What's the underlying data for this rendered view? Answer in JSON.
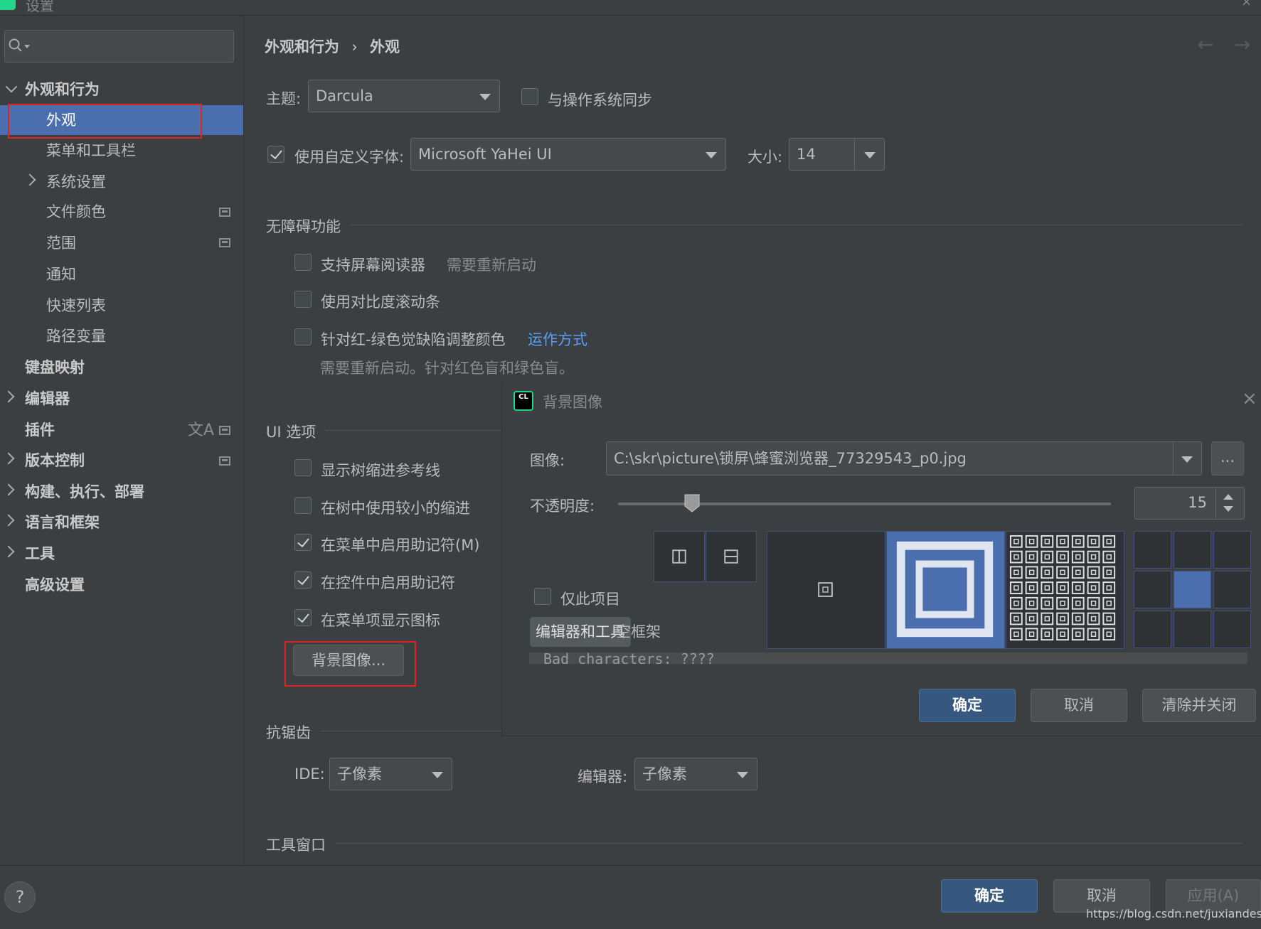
{
  "window": {
    "title": "设置"
  },
  "search": {
    "placeholder": ""
  },
  "sidebar": {
    "items": [
      {
        "label": "外观和行为"
      },
      {
        "label": "外观"
      },
      {
        "label": "菜单和工具栏"
      },
      {
        "label": "系统设置"
      },
      {
        "label": "文件颜色"
      },
      {
        "label": "范围"
      },
      {
        "label": "通知"
      },
      {
        "label": "快速列表"
      },
      {
        "label": "路径变量"
      },
      {
        "label": "键盘映射"
      },
      {
        "label": "编辑器"
      },
      {
        "label": "插件"
      },
      {
        "label": "版本控制"
      },
      {
        "label": "构建、执行、部署"
      },
      {
        "label": "语言和框架"
      },
      {
        "label": "工具"
      },
      {
        "label": "高级设置"
      }
    ]
  },
  "breadcrumb": {
    "parent": "外观和行为",
    "sep": "›",
    "current": "外观"
  },
  "theme": {
    "label": "主题:",
    "value": "Darcula",
    "sync_label": "与操作系统同步"
  },
  "font": {
    "use_custom_label": "使用自定义字体:",
    "value": "Microsoft YaHei UI",
    "size_label": "大小:",
    "size_value": "14"
  },
  "accessibility": {
    "title": "无障碍功能",
    "screen_reader": "支持屏幕阅读器",
    "restart_note": "需要重新启动",
    "contrast_scrollbars": "使用对比度滚动条",
    "color_deficiency": "针对红-绿色觉缺陷调整颜色",
    "how_it_works": "运作方式",
    "color_note": "需要重新启动。针对红色盲和绿色盲。"
  },
  "ui_options": {
    "title": "UI 选项",
    "tree_indent": "显示树缩进参考线",
    "smaller_indent": "在树中使用较小的缩进",
    "mnemonics_menu": "在菜单中启用助记符(M)",
    "mnemonics_controls": "在控件中启用助记符",
    "menu_icons": "在菜单项显示图标",
    "background_button": "背景图像..."
  },
  "antialiasing": {
    "title": "抗锯齿",
    "ide_label": "IDE:",
    "ide_value": "子像素",
    "editor_label": "编辑器:",
    "editor_value": "子像素"
  },
  "tool_windows": {
    "title": "工具窗口"
  },
  "dialog": {
    "icon_text": "CL",
    "title": "背景图像",
    "close": "×",
    "image_label": "图像:",
    "image_path": "C:\\skr\\picture\\锁屏\\蜂蜜浏览器_77329543_p0.jpg",
    "browse": "...",
    "opacity_label": "不透明度:",
    "opacity_value": "15",
    "opacity_fraction": 0.15,
    "this_project_only": "仅此项目",
    "target_editor_tools": "编辑器和工具",
    "target_empty_frame": "空框架",
    "preview_text": "Bad characters: ????",
    "ok": "确定",
    "cancel": "取消",
    "clear_close": "清除并关闭"
  },
  "footer": {
    "help": "?",
    "ok": "确定",
    "cancel": "取消",
    "apply": "应用(A)",
    "watermark": "https://blog.csdn.net/juxiandesiyu"
  },
  "colors": {
    "background": "#3c3f41",
    "selection": "#4b6eaf",
    "primary_button": "#365880",
    "link": "#589df6",
    "annotation_red": "#e02424"
  }
}
